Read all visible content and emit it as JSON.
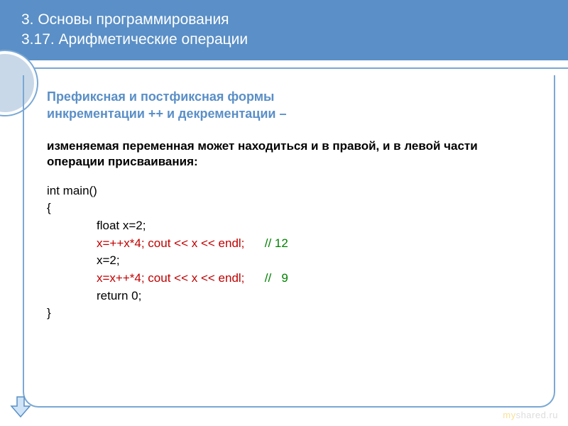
{
  "header": {
    "line1": "3. Основы программирования",
    "line2": "3.17. Арифметические операции"
  },
  "subtitle": {
    "line1": "Префиксная и постфиксная формы",
    "line2": "инкрементации ++ и декрементации –"
  },
  "paragraph": "изменяемая переменная может находиться и в правой, и в левой части операции присваивания:",
  "code": {
    "l1": "int main()",
    "l2": "{",
    "l3": "float x=2;",
    "l4a": "x=++x*4; cout << x << endl;",
    "l4b": "// 12",
    "l5": "x=2;",
    "l6a": "x=x++*4; cout << x << endl;",
    "l6b": "//   9",
    "l7": "return 0;",
    "l8": "}"
  },
  "watermark": {
    "my": "my",
    "rest": "shared.ru"
  },
  "icons": {
    "arrow": "down-arrow-icon"
  }
}
